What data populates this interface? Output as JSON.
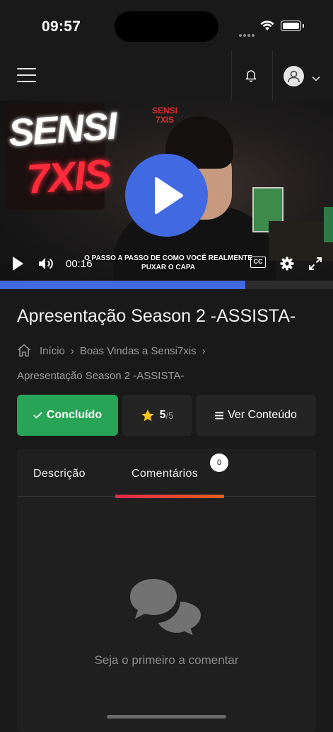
{
  "status_bar": {
    "time": "09:57"
  },
  "nav": {
    "menu_icon": "hamburger-icon",
    "bell_icon": "bell-icon",
    "avatar_icon": "user-icon",
    "chevron_icon": "chevron-down-icon"
  },
  "video": {
    "thumbnail_text_1": "SENSI",
    "thumbnail_text_2": "7XIS",
    "thumbnail_sign": "SENSI 7XIS",
    "caption": "O PASSO A PASSO DE COMO VOCÊ REALMENTE PUXAR O CAPA",
    "time": "00:16",
    "cc_label": "CC",
    "progress": 0.737,
    "accent": "#4169e1"
  },
  "lesson": {
    "title": "Apresentação Season 2 -ASSISTA-",
    "breadcrumb": {
      "home": "Início",
      "section": "Boas Vindas a Sensi7xis",
      "current": "Apresentação Season 2 -ASSISTA-"
    }
  },
  "actions": {
    "done_label": "Concluído",
    "rating_value": "5",
    "rating_max": "/5",
    "content_label": "Ver Conteúdo",
    "done_color": "#28a457"
  },
  "tabs": {
    "description_label": "Descrição",
    "comments_label": "Comentários",
    "comments_count": "0"
  },
  "comments": {
    "empty_message": "Seja o primeiro a comentar"
  }
}
